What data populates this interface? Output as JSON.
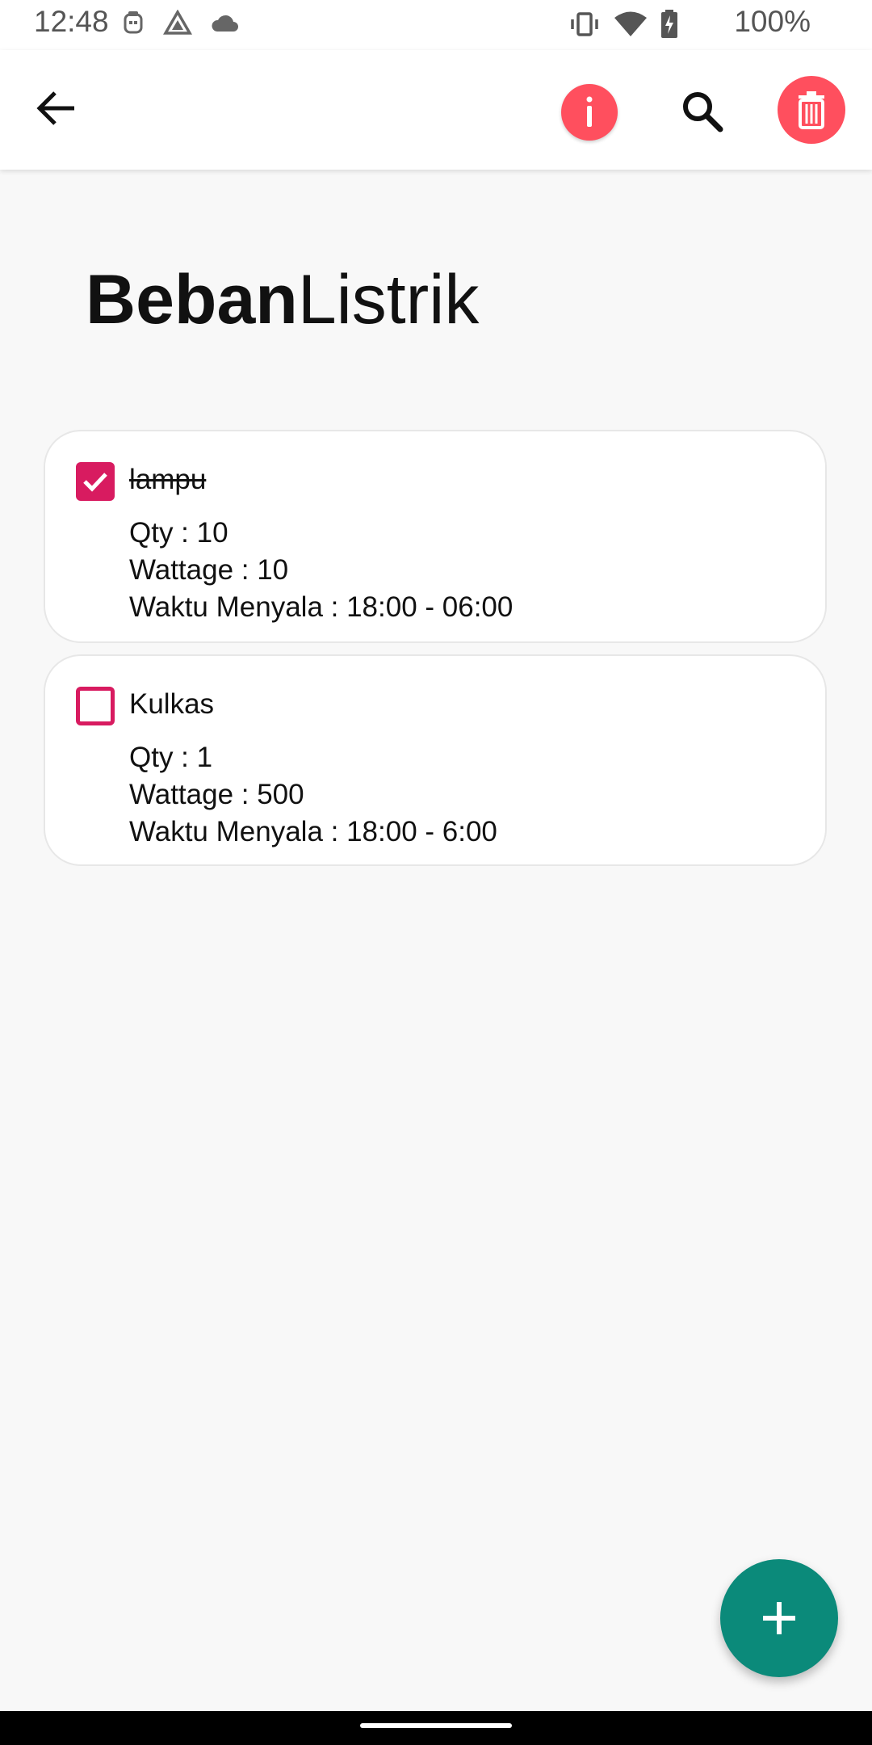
{
  "status_bar": {
    "time": "12:48",
    "battery_percent": "100%",
    "icons": [
      "notification-icon",
      "drive-icon",
      "cloud-icon",
      "vibrate-icon",
      "wifi-icon",
      "battery-charging-icon"
    ]
  },
  "app_bar": {
    "back_icon": "arrow-back-icon",
    "info_icon": "info-icon",
    "search_icon": "search-icon",
    "delete_icon": "trash-icon"
  },
  "title": {
    "bold": "Beban",
    "light": "Listrik"
  },
  "items": [
    {
      "name": "lampu",
      "checked": true,
      "qty": "Qty : 10",
      "wattage": "Wattage : 10",
      "time": "Waktu Menyala : 18:00 - 06:00"
    },
    {
      "name": "Kulkas",
      "checked": false,
      "qty": "Qty : 1",
      "wattage": "Wattage : 500",
      "time": "Waktu Menyala : 18:00 - 6:00"
    }
  ],
  "fab_icon": "plus-icon",
  "colors": {
    "accent_red": "#ff4f5e",
    "checkbox": "#d81b60",
    "fab": "#0b8a7a"
  }
}
